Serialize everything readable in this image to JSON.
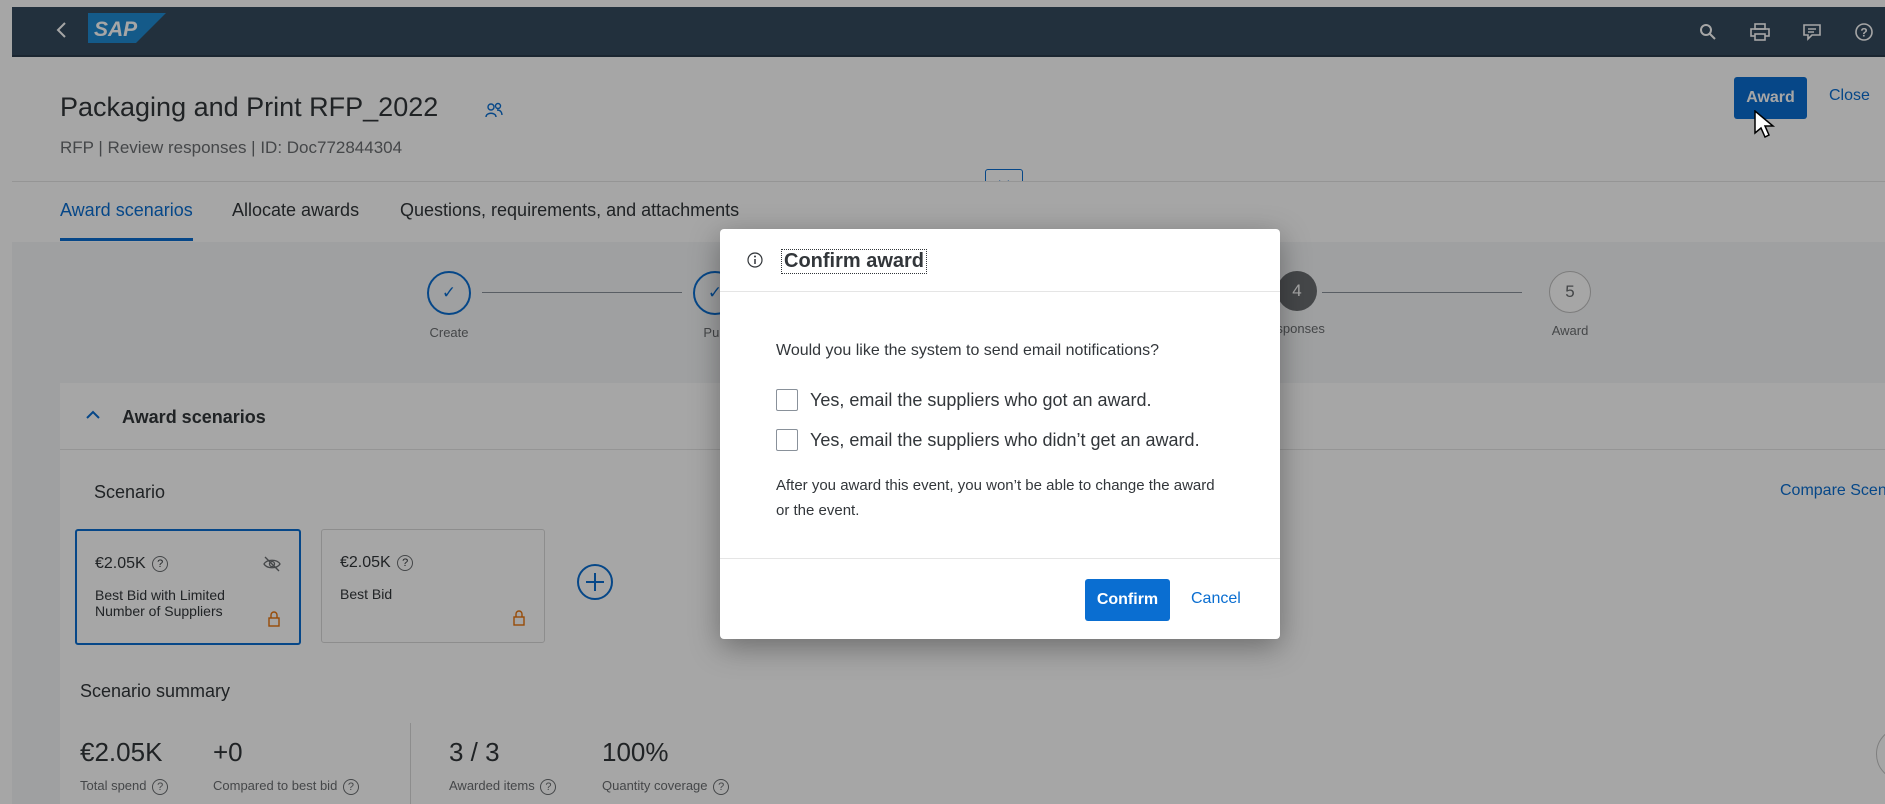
{
  "shell": {
    "logo_text": "SAP",
    "icons": [
      "back-icon",
      "search-icon",
      "printer-icon",
      "feedback-icon",
      "help-icon"
    ],
    "brand_color": "#354a5f",
    "accent_color": "#0a6ed1"
  },
  "header": {
    "title": "Packaging and Print RFP_2022",
    "subtitle": "RFP  |  Review responses  | ID: Doc772844304",
    "award_label": "Award",
    "close_label": "Close"
  },
  "tabs": [
    {
      "label": "Award scenarios",
      "active": true
    },
    {
      "label": "Allocate awards",
      "active": false
    },
    {
      "label": "Questions, requirements, and attachments",
      "active": false
    }
  ],
  "progress": {
    "steps": [
      {
        "num": "✓",
        "label": "Create",
        "state": "done"
      },
      {
        "num": "✓",
        "label": "Pub",
        "state": "done"
      },
      {
        "num": "4",
        "label": "esponses",
        "state": "current"
      },
      {
        "num": "5",
        "label": "Award",
        "state": "todo"
      }
    ]
  },
  "panel": {
    "title": "Award scenarios",
    "scenario_label": "Scenario",
    "compare_label": "Compare Scen",
    "cards": [
      {
        "value": "€2.05K",
        "desc": "Best Bid with Limited Number of Suppliers",
        "selected": true
      },
      {
        "value": "€2.05K",
        "desc": "Best Bid",
        "selected": false
      }
    ],
    "summary_title": "Scenario summary",
    "metrics": [
      {
        "value": "€2.05K",
        "label": "Total spend"
      },
      {
        "value": "+0",
        "label": "Compared to best bid"
      },
      {
        "value": "3 / 3",
        "label": "Awarded items"
      },
      {
        "value": "100%",
        "label": "Quantity coverage"
      }
    ]
  },
  "dialog": {
    "title": "Confirm award",
    "question": "Would you like the system to send email notifications?",
    "option1": "Yes, email the suppliers who got an award.",
    "option2": "Yes, email the suppliers who didn’t get an award.",
    "note": "After you award this event, you won’t be able to change the award or the event.",
    "confirm_label": "Confirm",
    "cancel_label": "Cancel"
  }
}
